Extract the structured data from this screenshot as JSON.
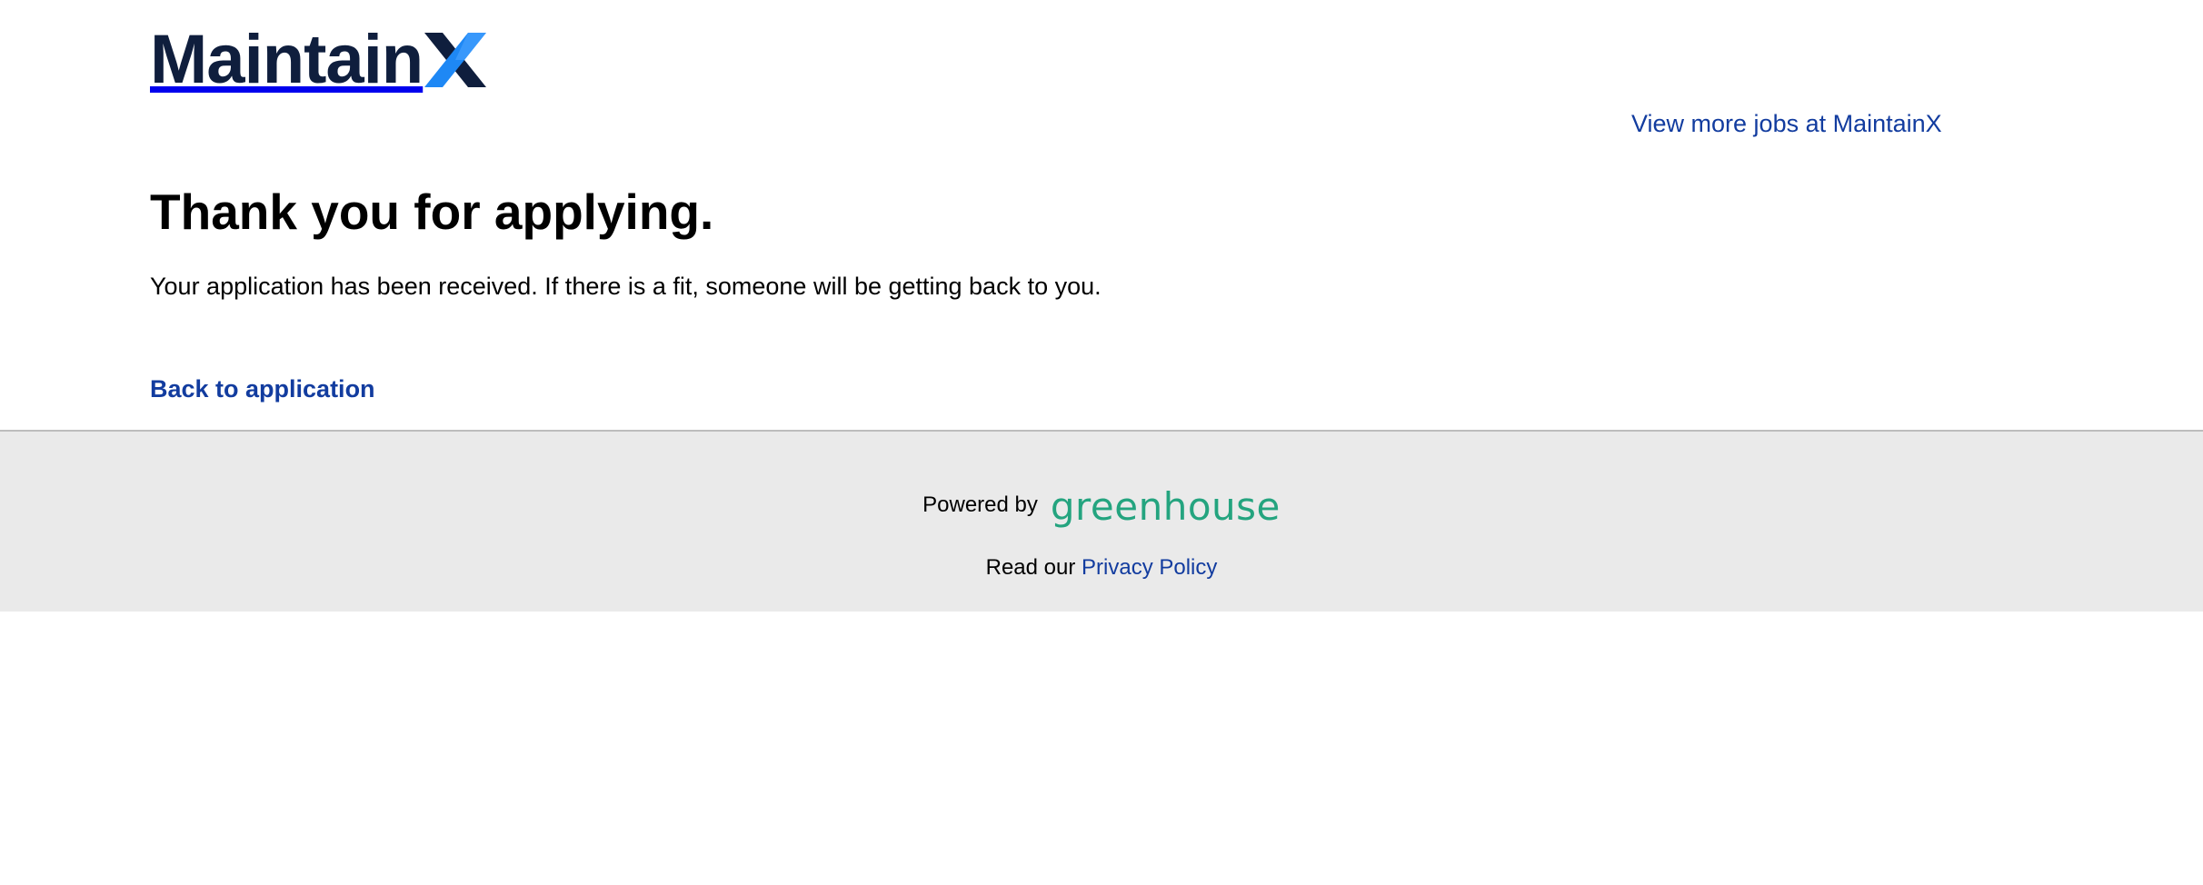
{
  "header": {
    "logo_text": "Maintain",
    "logo_x": "X",
    "view_more_jobs": "View more jobs at MaintainX"
  },
  "main": {
    "title": "Thank you for applying.",
    "message": "Your application has been received. If there is a fit, someone will be getting back to you.",
    "back_link": "Back to application"
  },
  "footer": {
    "powered_by": "Powered by",
    "greenhouse_logo": "greenhouse",
    "read_our": "Read our ",
    "privacy_link": "Privacy Policy"
  },
  "colors": {
    "link": "#123c9f",
    "logo_dark": "#0f1e3d",
    "logo_blue": "#1e88f5",
    "greenhouse_green": "#24a47f",
    "footer_bg": "#eaeaea"
  }
}
